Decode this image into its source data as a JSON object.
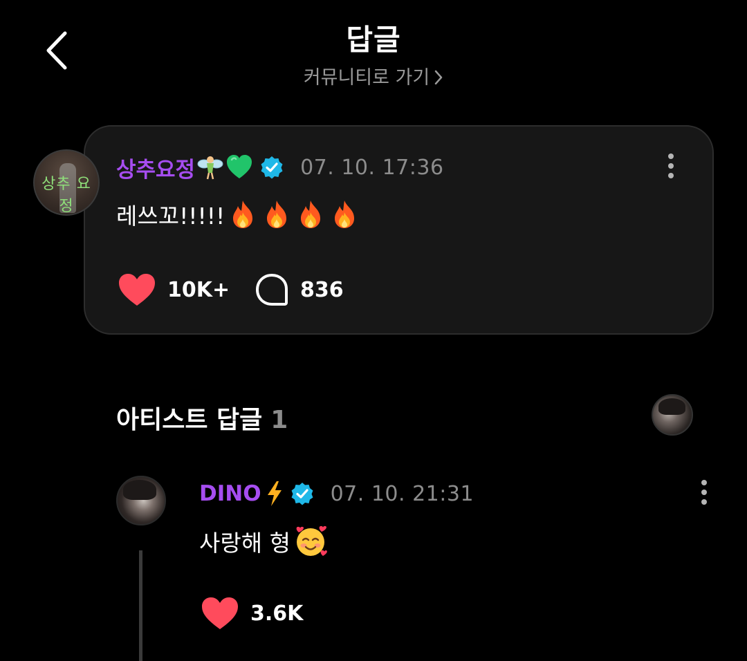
{
  "header": {
    "title": "답글",
    "community_link": "커뮤니티로 가기"
  },
  "post": {
    "username": "상추요정",
    "avatar_text": "상추 요정",
    "name_emojis": [
      "fairy",
      "green-heart"
    ],
    "verified": true,
    "timestamp": "07. 10. 17:36",
    "text": "레쓰꼬!!!!!",
    "text_emojis": [
      "fire",
      "fire",
      "fire",
      "fire"
    ],
    "likes": "10K+",
    "comments": "836"
  },
  "artist_replies": {
    "title": "아티스트 답글",
    "count": "1"
  },
  "reply": {
    "username": "DINO",
    "name_emoji": "lightning",
    "verified": true,
    "timestamp": "07. 10. 21:31",
    "text": "사랑해 형",
    "text_emoji": "smiling-face-with-hearts",
    "likes": "3.6K"
  },
  "colors": {
    "background": "#000000",
    "card": "#171717",
    "username": "#a64df0",
    "verified": "#1fb8e8",
    "heart": "#ff4b5c",
    "muted": "#8c8c8c"
  }
}
